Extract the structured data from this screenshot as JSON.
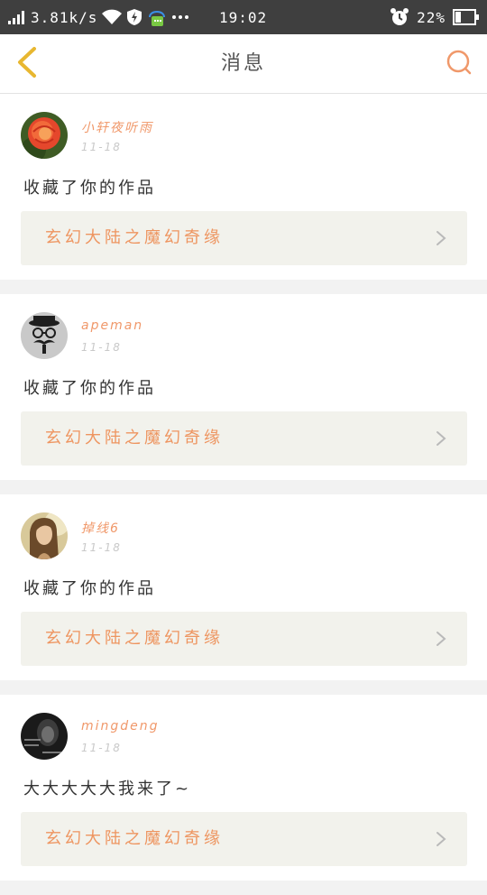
{
  "status_bar": {
    "network_speed": "3.81k/s",
    "time": "19:02",
    "battery": "22%",
    "icons": [
      "signal-icon",
      "wifi-icon",
      "shield-icon",
      "chat-bubble-icon",
      "more-dots-icon",
      "alarm-icon",
      "battery-icon"
    ]
  },
  "header": {
    "title": "消息",
    "back_icon": "chevron-left-icon",
    "search_icon": "search-icon"
  },
  "messages": [
    {
      "username": "小轩夜听雨",
      "time": "11-18",
      "text": "收藏了你的作品",
      "work_title": "玄幻大陆之魔幻奇缘",
      "avatar": "rose-avatar"
    },
    {
      "username": "apeman",
      "time": "11-18",
      "text": "收藏了你的作品",
      "work_title": "玄幻大陆之魔幻奇缘",
      "avatar": "mustache-man-avatar"
    },
    {
      "username": "掉线6",
      "time": "11-18",
      "text": "收藏了你的作品",
      "work_title": "玄幻大陆之魔幻奇缘",
      "avatar": "girl-portrait-avatar"
    },
    {
      "username": "mingdeng",
      "time": "11-18",
      "text": "大大大大大我来了~",
      "work_title": "玄幻大陆之魔幻奇缘",
      "avatar": "dark-portrait-avatar"
    }
  ],
  "colors": {
    "accent": "#f0986a",
    "header_icon": "#e8b730",
    "status_bar": "#3f3f3f"
  }
}
